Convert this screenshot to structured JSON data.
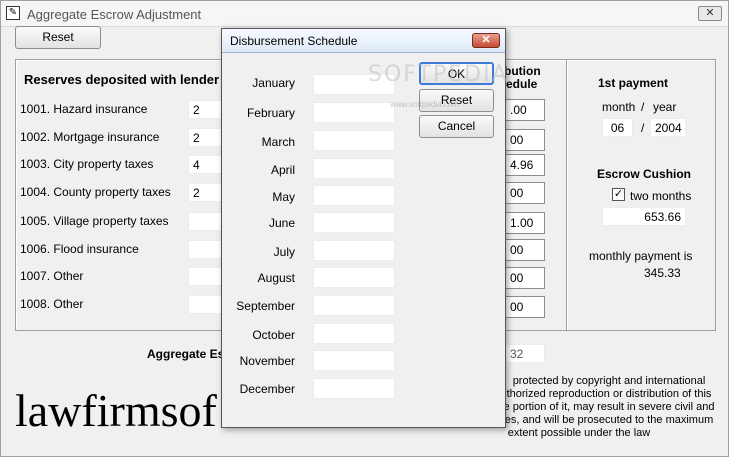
{
  "window": {
    "title": "Aggregate Escrow Adjustment",
    "close_glyph": "✕"
  },
  "toolbar": {
    "reset_label": "Reset"
  },
  "reserves": {
    "heading": "Reserves deposited with lender at c",
    "rows": [
      {
        "label": "1001.  Hazard insurance",
        "value": "2"
      },
      {
        "label": "1002.  Mortgage insurance",
        "value": "2"
      },
      {
        "label": "1003.  City property taxes",
        "value": "4"
      },
      {
        "label": "1004.  County property taxes",
        "value": "2"
      },
      {
        "label": "1005.  Village property taxes",
        "value": ""
      },
      {
        "label": "1006.  Flood insurance",
        "value": ""
      },
      {
        "label": "1007.  Other",
        "value": ""
      },
      {
        "label": "1008.  Other",
        "value": ""
      }
    ]
  },
  "contribution": {
    "heading_line1": "bution",
    "heading_line2": "edule",
    "values": [
      ".00",
      "00",
      "4.96",
      "00",
      "1.00",
      "00",
      "00",
      "00"
    ]
  },
  "first_payment": {
    "heading": "1st payment",
    "month_label": "month",
    "slash": "/",
    "year_label": "year",
    "month": "06",
    "year": "2004"
  },
  "escrow_cushion": {
    "heading": "Escrow Cushion",
    "checkbox_label": "two months",
    "checked": true,
    "amount": "653.66",
    "monthly_label": "monthly payment is",
    "monthly_value": "345.33"
  },
  "aggregate": {
    "label": "Aggregate Es",
    "value": "32"
  },
  "logo": {
    "text": "lawfirmsof"
  },
  "copyright": {
    "lines": [
      "protected by copyright and international",
      "thorized reproduction or distribution of this",
      "e portion of it, may result in severe civil and",
      "es, and will be prosecuted to the maximum",
      "extent possible under the law"
    ]
  },
  "watermark": {
    "text": "SOFTPEDIA",
    "sub": "www.softpedia.com"
  },
  "dialog": {
    "title": "Disbursement Schedule",
    "close_glyph": "✕",
    "ok_label": "OK",
    "reset_label": "Reset",
    "cancel_label": "Cancel",
    "months": [
      "January",
      "February",
      "March",
      "April",
      "May",
      "June",
      "July",
      "August",
      "September",
      "October",
      "November",
      "December"
    ]
  }
}
